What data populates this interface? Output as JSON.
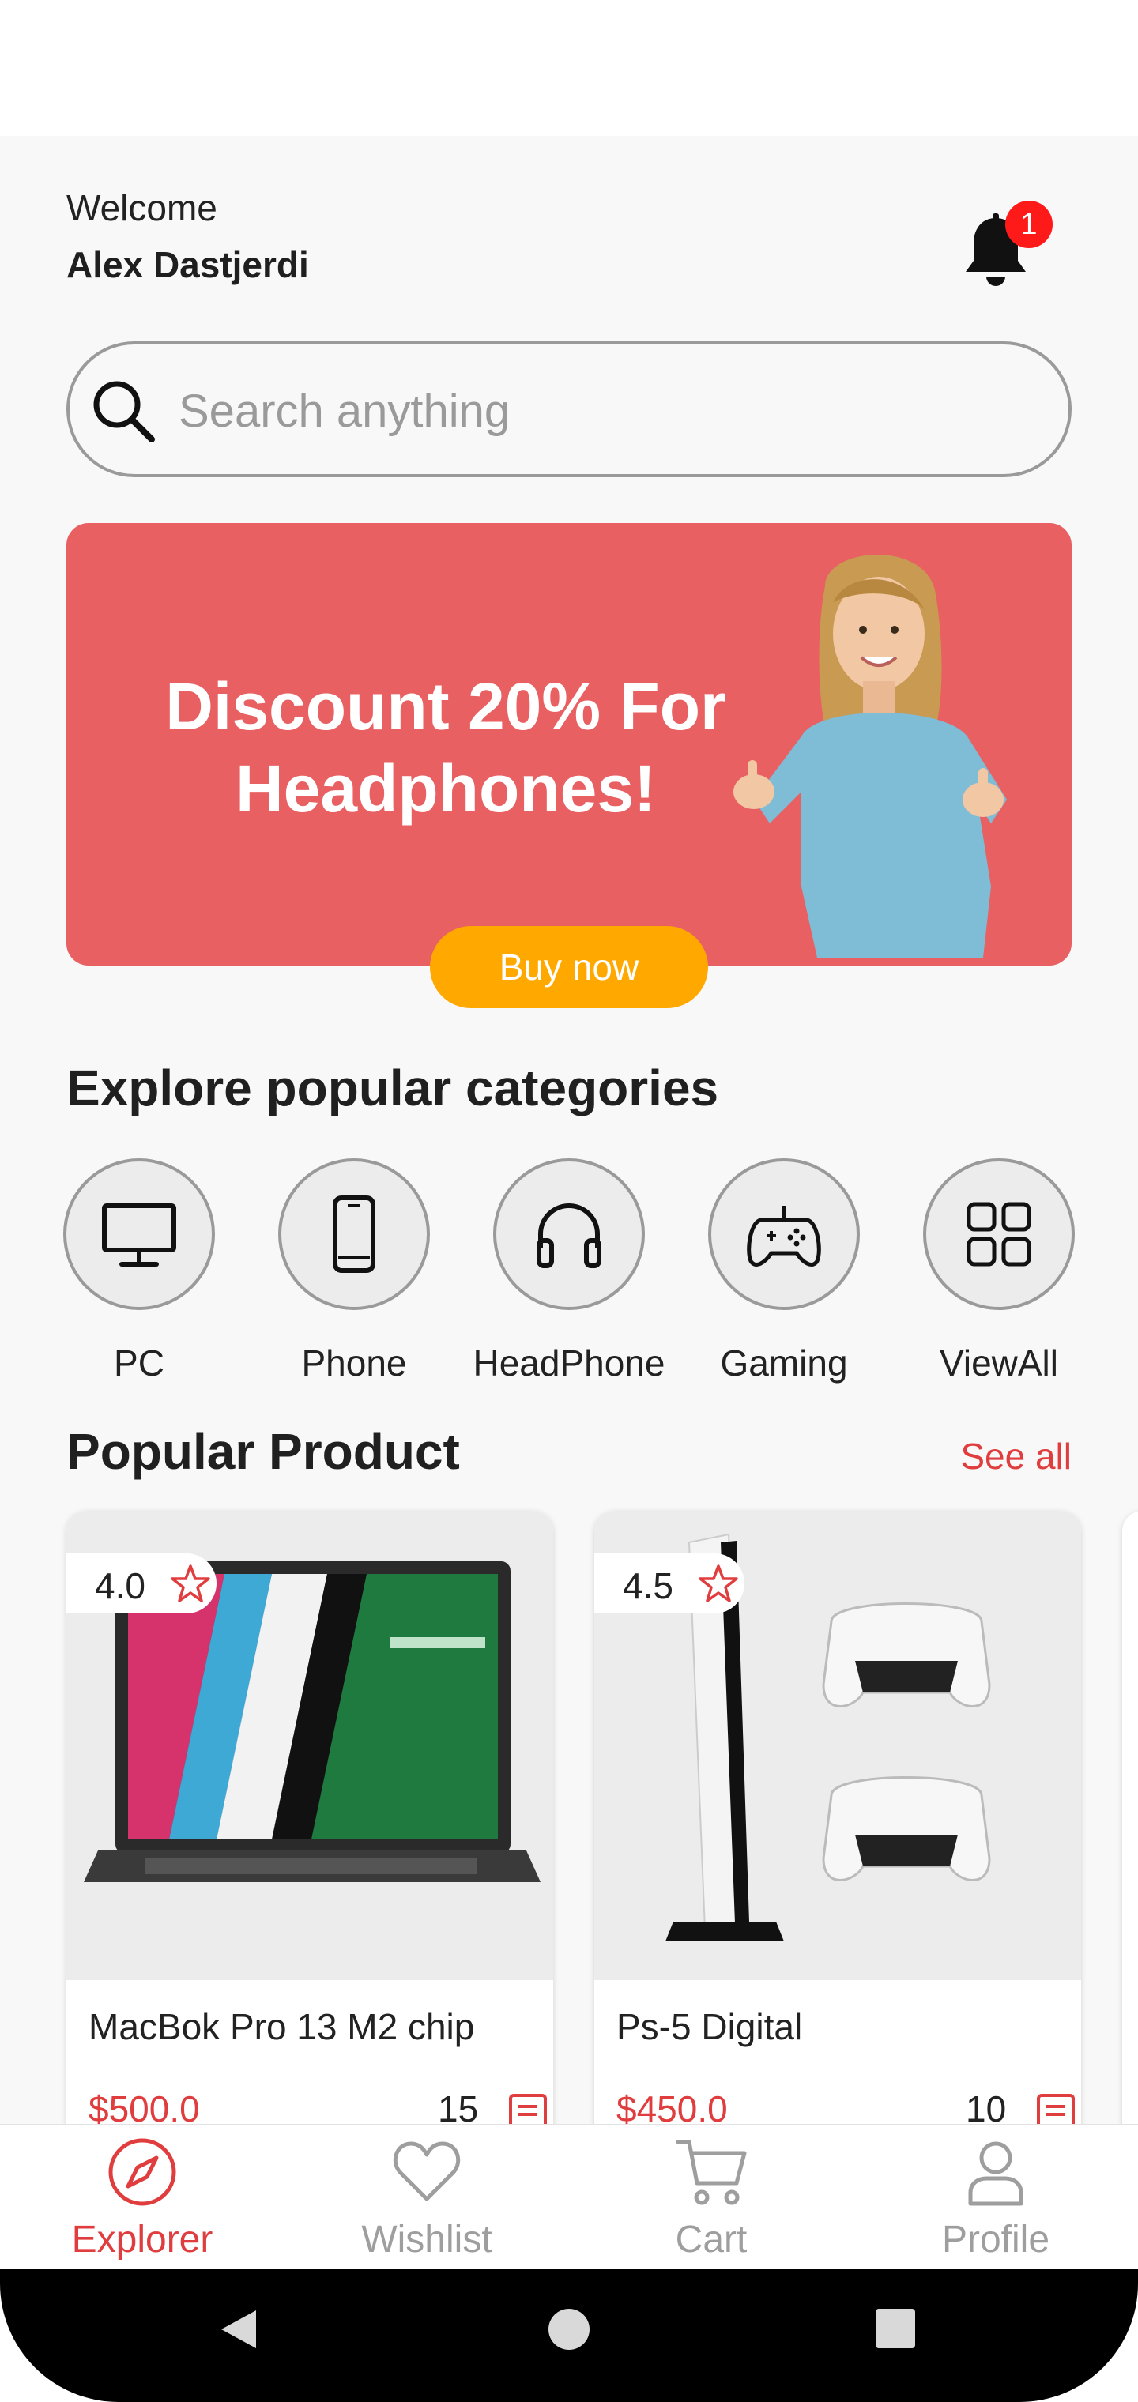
{
  "header": {
    "welcome_label": "Welcome",
    "user_name": "Alex Dastjerdi",
    "notification_count": "1"
  },
  "search": {
    "placeholder": "Search anything"
  },
  "banner": {
    "headline": "Discount 20% For Headphones!",
    "cta_label": "Buy now",
    "background_color": "#e86062",
    "cta_color": "#ffa800"
  },
  "categories": {
    "title": "Explore popular categories",
    "items": [
      {
        "label": "PC",
        "icon": "monitor-icon"
      },
      {
        "label": "Phone",
        "icon": "phone-icon"
      },
      {
        "label": "HeadPhone",
        "icon": "headphones-icon"
      },
      {
        "label": "Gaming",
        "icon": "gamepad-icon"
      },
      {
        "label": "ViewAll",
        "icon": "grid-icon"
      }
    ]
  },
  "popular": {
    "title": "Popular Product",
    "see_all_label": "See all",
    "products": [
      {
        "name": "MacBok Pro 13 M2 chip",
        "rating": "4.0",
        "price": "$500.0",
        "quantity": "15"
      },
      {
        "name": "Ps-5 Digital",
        "rating": "4.5",
        "price": "$450.0",
        "quantity": "10"
      }
    ]
  },
  "bottom_nav": {
    "items": [
      {
        "label": "Explorer",
        "icon": "compass-icon",
        "active": true
      },
      {
        "label": "Wishlist",
        "icon": "heart-icon",
        "active": false
      },
      {
        "label": "Cart",
        "icon": "cart-icon",
        "active": false
      },
      {
        "label": "Profile",
        "icon": "user-icon",
        "active": false
      }
    ]
  },
  "colors": {
    "accent": "#e03d3f",
    "badge": "#ff1a1a"
  }
}
